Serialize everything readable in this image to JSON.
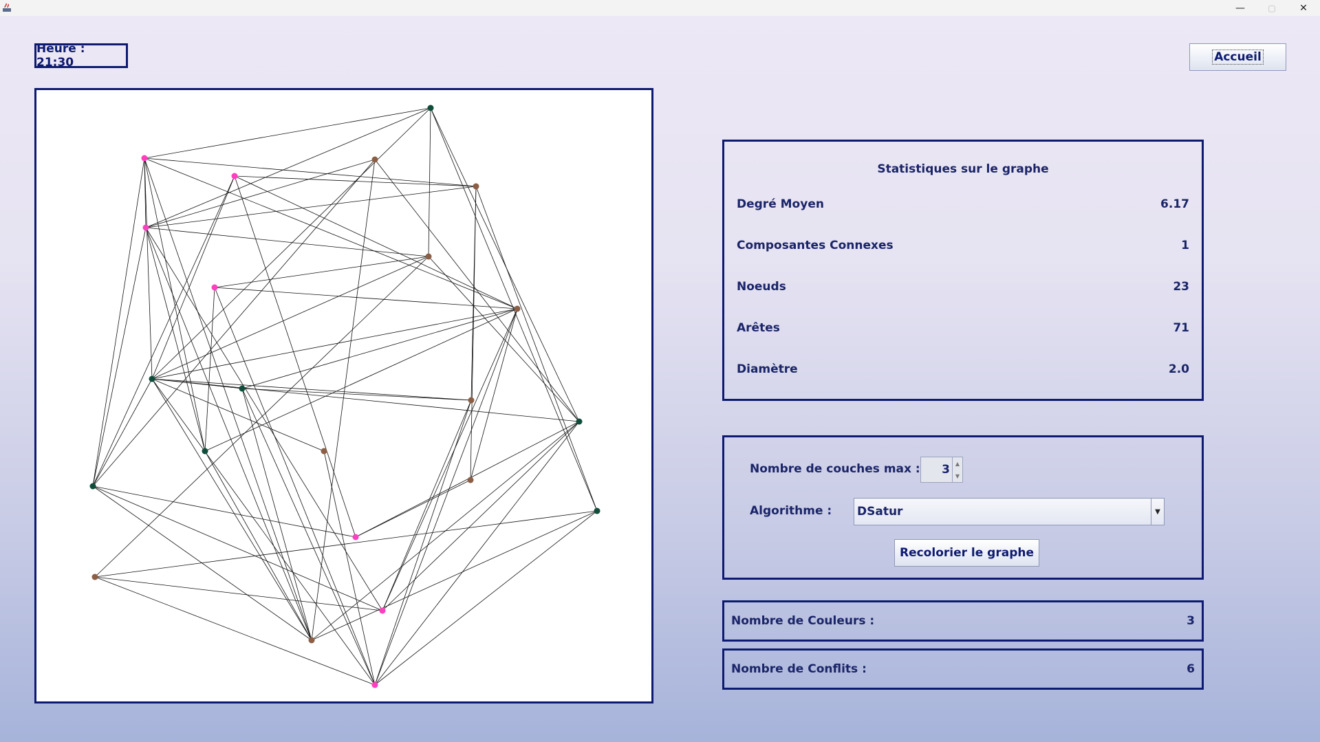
{
  "window": {
    "minimize_glyph": "—",
    "maximize_glyph": "▢",
    "close_glyph": "✕"
  },
  "header": {
    "clock_text": "Heure : 21:30",
    "home_button_label": "Accueil"
  },
  "stats": {
    "title": "Statistiques sur le graphe",
    "rows": [
      {
        "label": "Degré Moyen",
        "value": "6.17"
      },
      {
        "label": "Composantes Connexes",
        "value": "1"
      },
      {
        "label": "Noeuds",
        "value": "23"
      },
      {
        "label": "Arêtes",
        "value": "71"
      },
      {
        "label": "Diamètre",
        "value": "2.0"
      }
    ]
  },
  "params": {
    "max_layers_label": "Nombre de couches max :",
    "max_layers_value": "3",
    "algorithm_label": "Algorithme :",
    "algorithm_selected": "DSatur",
    "recolor_button_label": "Recolorier le graphe"
  },
  "results": {
    "colors_label": "Nombre de Couleurs :",
    "colors_value": "3",
    "conflicts_label": "Nombre de Conflits :",
    "conflicts_value": "6"
  },
  "graph": {
    "color_map": {
      "pink": "#ff3fbf",
      "brown": "#8b5e45",
      "green": "#0f4d3a"
    },
    "nodes": [
      {
        "id": "A",
        "color": "green"
      },
      {
        "id": "B",
        "color": "pink"
      },
      {
        "id": "C",
        "color": "brown"
      },
      {
        "id": "D",
        "color": "pink"
      },
      {
        "id": "E",
        "color": "brown"
      },
      {
        "id": "F",
        "color": "pink"
      },
      {
        "id": "G",
        "color": "brown"
      },
      {
        "id": "H",
        "color": "pink"
      },
      {
        "id": "I",
        "color": "brown"
      },
      {
        "id": "J",
        "color": "green"
      },
      {
        "id": "K",
        "color": "green"
      },
      {
        "id": "L",
        "color": "brown"
      },
      {
        "id": "M",
        "color": "green"
      },
      {
        "id": "N",
        "color": "green"
      },
      {
        "id": "O",
        "color": "brown"
      },
      {
        "id": "P",
        "color": "brown"
      },
      {
        "id": "Q",
        "color": "green"
      },
      {
        "id": "R",
        "color": "green"
      },
      {
        "id": "S",
        "color": "pink"
      },
      {
        "id": "T",
        "color": "brown"
      },
      {
        "id": "U",
        "color": "pink"
      },
      {
        "id": "V",
        "color": "brown"
      },
      {
        "id": "W",
        "color": "pink"
      }
    ]
  }
}
